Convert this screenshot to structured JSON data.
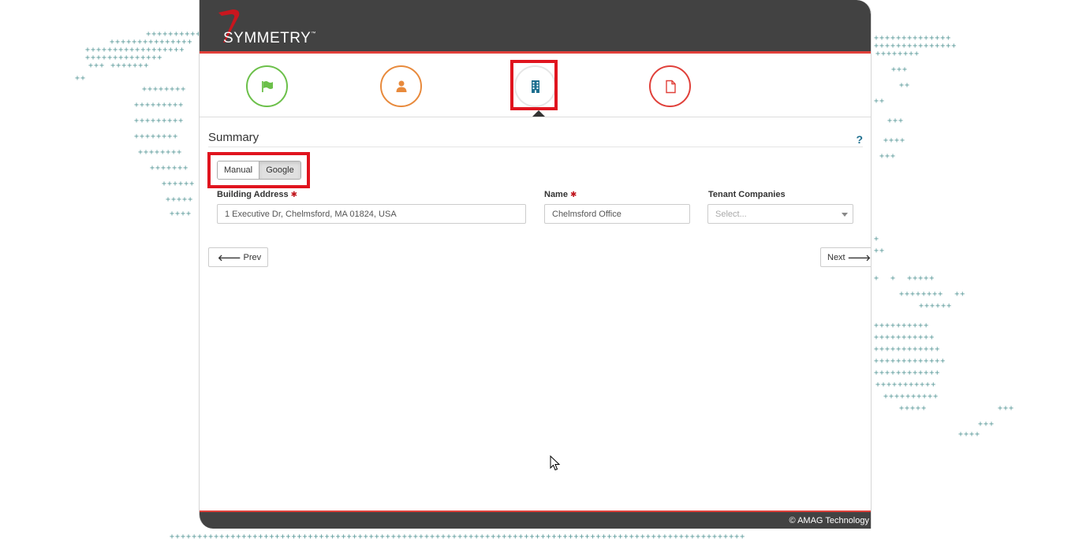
{
  "header": {
    "logo_text": "SYMMETRY",
    "logo_tm": "™"
  },
  "steps": [
    {
      "name": "flag",
      "icon": "flag-icon",
      "color": "#6cc04a"
    },
    {
      "name": "person",
      "icon": "user-icon",
      "color": "#e88a3c"
    },
    {
      "name": "building",
      "icon": "building-icon",
      "color": "#1e6f8f",
      "active": true
    },
    {
      "name": "document",
      "icon": "document-icon",
      "color": "#e0403a"
    }
  ],
  "summary": {
    "title": "Summary",
    "help": "?"
  },
  "mode_toggle": {
    "manual_label": "Manual",
    "google_label": "Google",
    "selected": "Google"
  },
  "form": {
    "building_address": {
      "label": "Building Address",
      "value": "1 Executive Dr, Chelmsford, MA 01824, USA",
      "required": "✱"
    },
    "name": {
      "label": "Name",
      "value": "Chelmsford Office",
      "required": "✱"
    },
    "tenant_companies": {
      "label": "Tenant Companies",
      "placeholder": "Select..."
    }
  },
  "nav": {
    "prev_label": "Prev",
    "next_label": "Next"
  },
  "footer": {
    "copyright": "© AMAG Technology"
  }
}
